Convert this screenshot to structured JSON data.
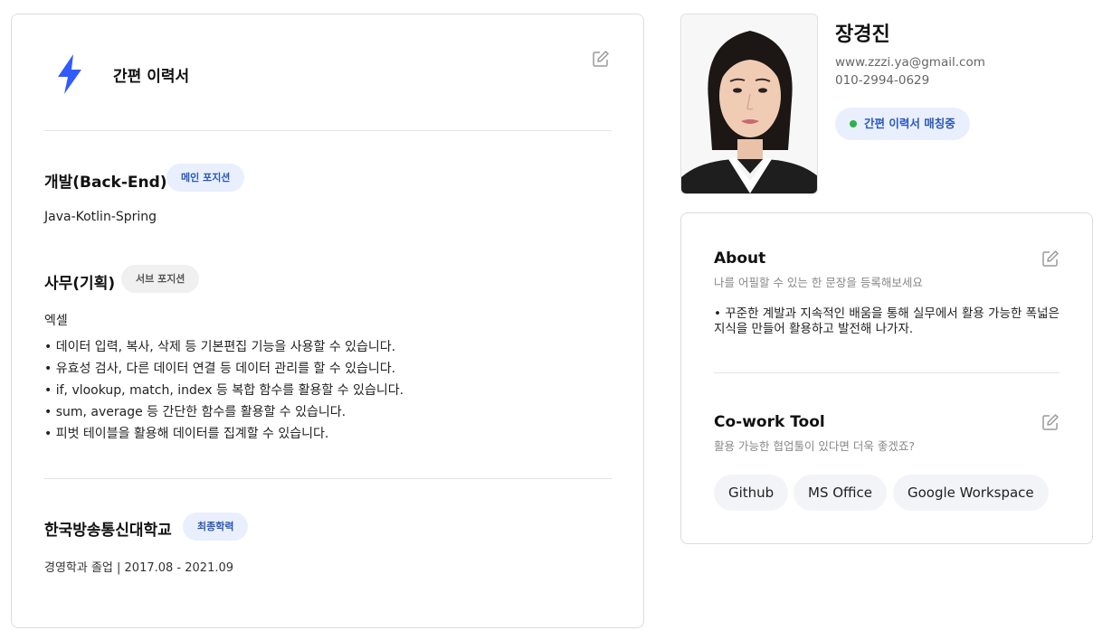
{
  "resume": {
    "title": "간편 이력서",
    "main_position": {
      "name": "개발(Back-End)",
      "badge": "메인 포지션",
      "skills": "Java-Kotlin-Spring"
    },
    "sub_position": {
      "name": "사무(기획)",
      "badge": "서브 포지션",
      "skill_title": "엑셀",
      "items": [
        "데이터 입력, 복사, 삭제 등 기본편집 기능을 사용할 수 있습니다.",
        "유효성 검사, 다른 데이터 연결 등 데이터 관리를 할 수 있습니다.",
        "if, vlookup, match, index 등 복합 함수를 활용할 수 있습니다.",
        "sum, average 등 간단한 함수를 활용할 수 있습니다.",
        "피벗 테이블을 활용해 데이터를 집계할 수 있습니다."
      ]
    },
    "education": {
      "school": "한국방송통신대학교",
      "badge": "최종학력",
      "detail": "경영학과 졸업 | 2017.08 - 2021.09"
    }
  },
  "profile": {
    "name": "장경진",
    "email": "www.zzzi.ya@gmail.com",
    "phone": "010-2994-0629",
    "status": "간편 이력서 매칭중"
  },
  "about": {
    "heading": "About",
    "subheading": "나를 어필할 수 있는 한 문장을 등록해보세요",
    "text": "• 꾸준한 계발과 지속적인 배움을 통해 실무에서 활용 가능한 폭넓은 지식을 만들어 활용하고 발전해 나가자."
  },
  "cowork": {
    "heading": "Co-work Tool",
    "subheading": "활용 가능한 협업툴이 있다면 더욱 좋겠죠?",
    "tools": [
      "Github",
      "MS Office",
      "Google Workspace"
    ]
  },
  "colors": {
    "accent": "#2f5bff",
    "badge_bg": "#e9effd",
    "status_dot": "#2bb34a"
  },
  "icons": [
    "lightning-icon",
    "edit-icon",
    "status-dot"
  ]
}
